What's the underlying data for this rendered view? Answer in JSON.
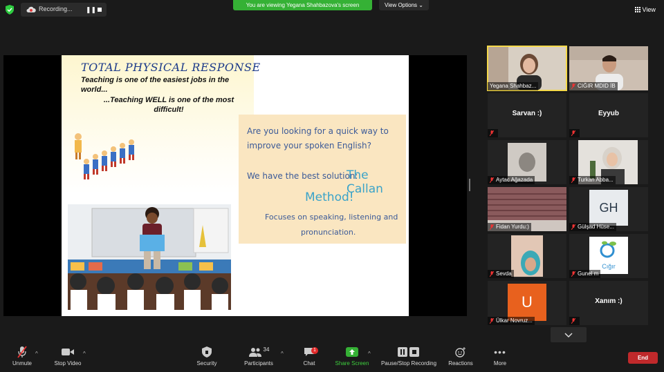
{
  "recording": {
    "label": "Recording..."
  },
  "banner": {
    "viewing": "You are viewing Yegana Shahbazova's screen",
    "view_options": "View Options"
  },
  "view_button": "View",
  "slide": {
    "title": "TOTAL PHYSICAL RESPONSE",
    "quote_line1": "Teaching is one of the easiest jobs in the world...",
    "quote_line2": "...Teaching WELL is one of the most difficult!",
    "callan_q": "Are you looking for a quick way to improve your spoken English?",
    "callan_best": "We have the best solution:",
    "callan_name1": "The Callan",
    "callan_name2": "Method!",
    "callan_focus1": "Focuses on speaking, listening and",
    "callan_focus2": "pronunciation."
  },
  "participants": [
    {
      "name": "Yegana Shahbaz...",
      "type": "video",
      "active": true
    },
    {
      "name": "CIĞIR MDID İB",
      "type": "video"
    },
    {
      "name": "",
      "center": "Sarvan :)",
      "type": "name"
    },
    {
      "name": "",
      "center": "Eyyub",
      "type": "name"
    },
    {
      "name": "Aytac Ağazada",
      "type": "video"
    },
    {
      "name": "Turkan Abba...",
      "type": "video"
    },
    {
      "name": "Fidan Yurdu:)",
      "type": "video"
    },
    {
      "name": "Gülşad Hüse...",
      "type": "initials",
      "initials": "GH"
    },
    {
      "name": "Sevda",
      "type": "video"
    },
    {
      "name": "Gunel m",
      "type": "logo",
      "logo_text": "Cığır"
    },
    {
      "name": "Ülkar Novruz...",
      "type": "initials",
      "initials": "U"
    },
    {
      "name": "",
      "center": "Xanım :)",
      "type": "name"
    }
  ],
  "toolbar": {
    "unmute": "Unmute",
    "stop_video": "Stop Video",
    "security": "Security",
    "participants": "Participants",
    "participants_count": "34",
    "chat": "Chat",
    "chat_badge": "1",
    "share_screen": "Share Screen",
    "record": "Pause/Stop Recording",
    "reactions": "Reactions",
    "more": "More",
    "end": "End"
  },
  "colors": {
    "accent_green": "#35b135",
    "end_red": "#c0292b",
    "active_border": "#f5d94a",
    "slide_title": "#1c3a8a",
    "callan_blue": "#3aa3c9"
  }
}
